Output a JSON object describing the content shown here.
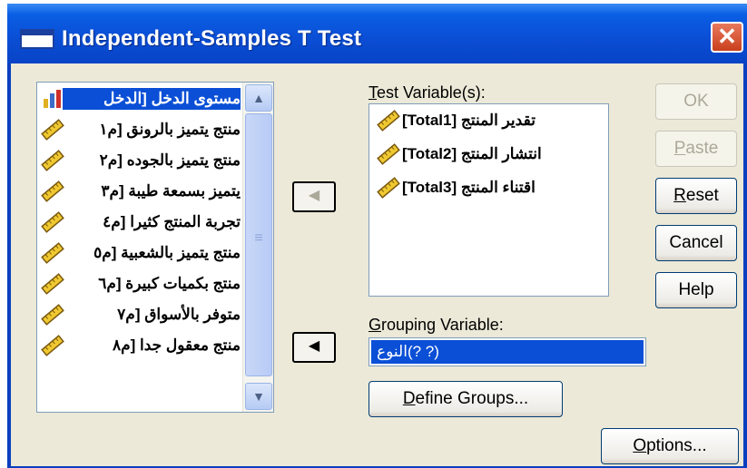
{
  "window": {
    "title": "Independent-Samples T Test",
    "close_glyph": "✕"
  },
  "source_list": {
    "items": [
      {
        "label": "مستوى الدخل [الدخل",
        "icon": "nominal-bar-icon"
      },
      {
        "label": "منتج يتميز بالرونق [م١",
        "icon": "scale-ruler-icon"
      },
      {
        "label": "منتج يتميز بالجوده [م٢",
        "icon": "scale-ruler-icon"
      },
      {
        "label": "يتميز بسمعة طيبة [م٣",
        "icon": "scale-ruler-icon"
      },
      {
        "label": "تجربة المنتج كثيرا [م٤",
        "icon": "scale-ruler-icon"
      },
      {
        "label": "منتج يتميز بالشعبية [م٥",
        "icon": "scale-ruler-icon"
      },
      {
        "label": "منتج بكميات كبيرة [م٦",
        "icon": "scale-ruler-icon"
      },
      {
        "label": "متوفر بالأسواق [م٧",
        "icon": "scale-ruler-icon"
      },
      {
        "label": "منتج معقول جدا [م٨",
        "icon": "scale-ruler-icon"
      }
    ]
  },
  "arrows": {
    "move_test": "◀",
    "move_group": "◀"
  },
  "test_variables": {
    "label": "Test Variable(s):",
    "accel": "T",
    "rest": "est Variable(s):",
    "items": [
      {
        "label": "تقدير المنتج [Total1]"
      },
      {
        "label": "انتشار المنتج [Total2]"
      },
      {
        "label": "اقتناء المنتج [Total3]"
      }
    ]
  },
  "grouping": {
    "accel": "G",
    "rest": "rouping Variable:",
    "value": "النوع(? ?)"
  },
  "buttons": {
    "ok": "OK",
    "paste_accel": "P",
    "paste_rest": "aste",
    "reset_accel": "R",
    "reset_rest": "eset",
    "cancel": "Cancel",
    "help": "Help",
    "define_accel": "D",
    "define_rest": "efine Groups...",
    "options_accel": "O",
    "options_rest": "ptions..."
  },
  "scrollbar": {
    "up": "▲",
    "down": "▼"
  }
}
